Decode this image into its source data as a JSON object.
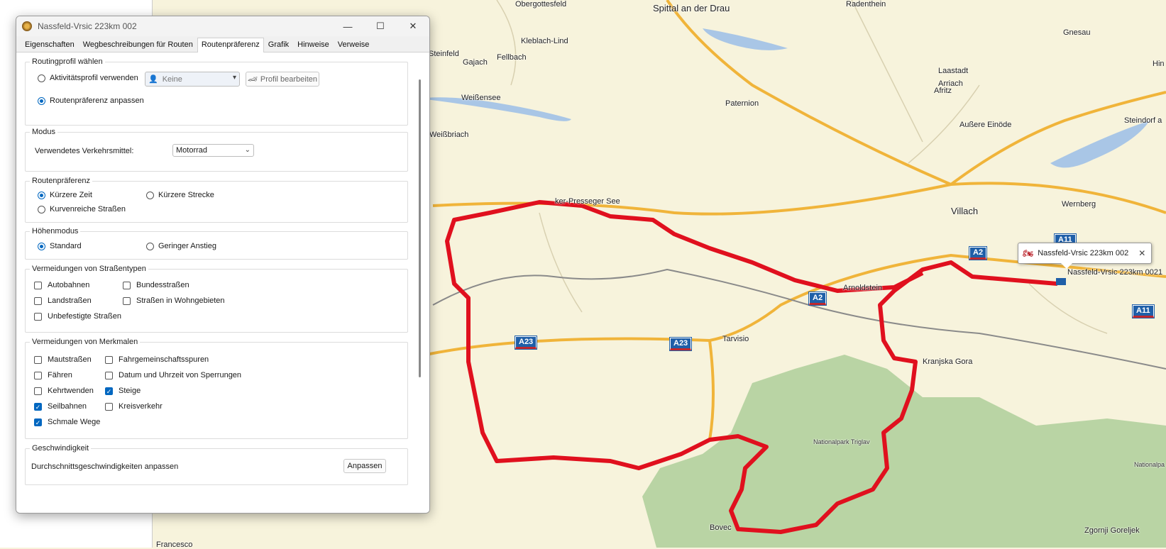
{
  "window": {
    "title": "Nassfeld-Vrsic 223km 002",
    "minimize": "—",
    "maximize": "☐",
    "close": "✕"
  },
  "tabs": [
    "Eigenschaften",
    "Wegbeschreibungen für Routen",
    "Routenpräferenz",
    "Grafik",
    "Hinweise",
    "Verweise"
  ],
  "active_tab": "Routenpräferenz",
  "routing_profile": {
    "title": "Routingprofil wählen",
    "use_activity_label": "Aktivitätsprofil verwenden",
    "profile_value": "Keine",
    "edit_profile_label": "Profil bearbeiten",
    "customize_label": "Routenpräferenz anpassen"
  },
  "mode": {
    "title": "Modus",
    "transport_label": "Verwendetes Verkehrsmittel:",
    "transport_value": "Motorrad"
  },
  "route_pref": {
    "title": "Routenpräferenz",
    "shorter_time": "Kürzere Zeit",
    "shorter_distance": "Kürzere Strecke",
    "curvy_roads": "Kurvenreiche Straßen"
  },
  "elevation": {
    "title": "Höhenmodus",
    "standard": "Standard",
    "low_climb": "Geringer Anstieg"
  },
  "avoid_roads": {
    "title": "Vermeidungen von Straßentypen",
    "highways": "Autobahnen",
    "federal_roads": "Bundesstraßen",
    "country_roads": "Landstraßen",
    "residential": "Straßen in Wohngebieten",
    "unpaved": "Unbefestigte Straßen"
  },
  "avoid_features": {
    "title": "Vermeidungen von Merkmalen",
    "tolls": "Mautstraßen",
    "carpool": "Fahrgemeinschaftsspuren",
    "ferries": "Fähren",
    "closures": "Datum und Uhrzeit von Sperrungen",
    "uturns": "Kehrtwenden",
    "climbs": "Steige",
    "cable_cars": "Seilbahnen",
    "roundabouts": "Kreisverkehr",
    "narrow_roads": "Schmale Wege"
  },
  "speed": {
    "title": "Geschwindigkeit",
    "label": "Durchschnittsgeschwindigkeiten anpassen",
    "button": "Anpassen"
  },
  "map": {
    "labels": [
      {
        "text": "Obergottesfeld"
      },
      {
        "text": "Spittal an der Drau"
      },
      {
        "text": "Radenthein"
      },
      {
        "text": "Gnesau"
      },
      {
        "text": "Kleblach-Lind"
      },
      {
        "text": "Steinfeld"
      },
      {
        "text": "Gajach"
      },
      {
        "text": "Fellbach"
      },
      {
        "text": "Laastadt"
      },
      {
        "text": "Arriach"
      },
      {
        "text": "Weißensee"
      },
      {
        "text": "Afritz"
      },
      {
        "text": "Paternion"
      },
      {
        "text": "Steindorf a"
      },
      {
        "text": "Außere Einöde"
      },
      {
        "text": "Weißbriach"
      },
      {
        "text": "Wernberg"
      },
      {
        "text": "Villach"
      },
      {
        "text": "Arnoldstein"
      },
      {
        "text": "Tarvisio"
      },
      {
        "text": "Kranjska Gora"
      },
      {
        "text": "Nationalpark Triglav"
      },
      {
        "text": "Nationalpa"
      },
      {
        "text": "Zgornji Goreljek"
      },
      {
        "text": "Francesco"
      },
      {
        "text": "Bovec"
      },
      {
        "text": "ker-Presseger See"
      },
      {
        "text": "Hin"
      }
    ],
    "shields": [
      "A2",
      "A2",
      "A11",
      "A11",
      "A23",
      "A23"
    ],
    "callout_title": "Nassfeld-Vrsic 223km 002",
    "waypoint_label": "Nassfeld-Vrsic 223km 0021",
    "route_color": "#e0101e",
    "park_color": "#b9d4a4",
    "lake_color": "#a9c6e6",
    "road_color": "#f0b43a"
  }
}
